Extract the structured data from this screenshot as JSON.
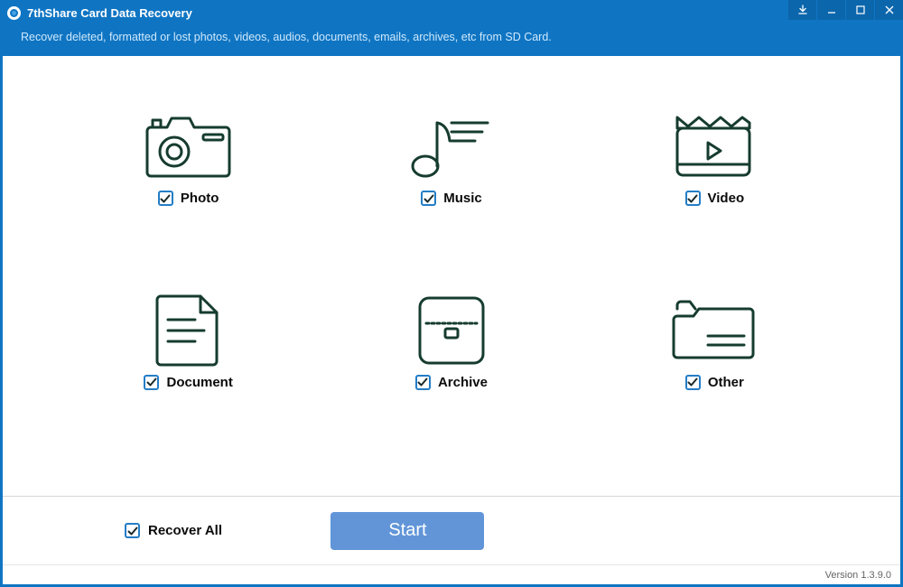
{
  "header": {
    "title": "7thShare Card Data Recovery",
    "subtitle": "Recover deleted, formatted or lost photos, videos, audios, documents, emails, archives, etc from SD Card."
  },
  "categories": [
    {
      "id": "photo",
      "label": "Photo",
      "checked": true
    },
    {
      "id": "music",
      "label": "Music",
      "checked": true
    },
    {
      "id": "video",
      "label": "Video",
      "checked": true
    },
    {
      "id": "document",
      "label": "Document",
      "checked": true
    },
    {
      "id": "archive",
      "label": "Archive",
      "checked": true
    },
    {
      "id": "other",
      "label": "Other",
      "checked": true
    }
  ],
  "recover_all": {
    "label": "Recover All",
    "checked": true
  },
  "start_label": "Start",
  "footer": {
    "version_label": "Version 1.3.9.0"
  },
  "colors": {
    "accent": "#0f75c3",
    "icon": "#163c2f",
    "check": "#1a2a2a",
    "button": "#6195d8"
  }
}
